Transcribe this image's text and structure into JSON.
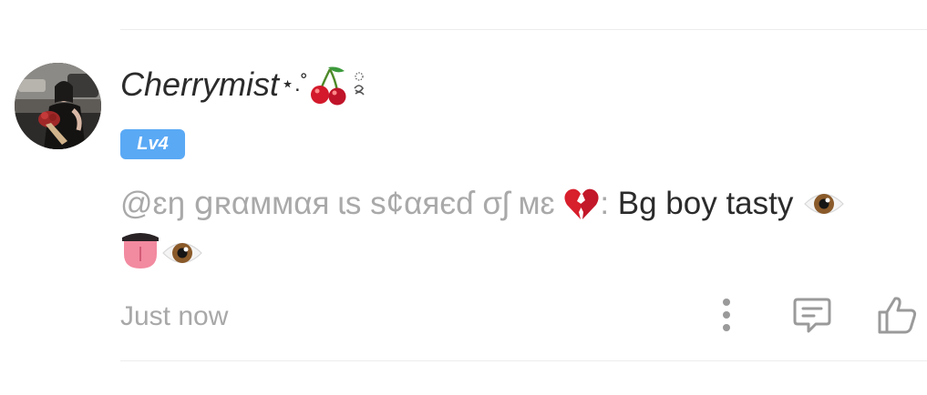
{
  "comment": {
    "username": "Cherrymist",
    "username_decoration": "⋆.˚",
    "level": "Lv4",
    "mention": "@ɛŋ ցʀαммαя ɩs s¢αяєɗ σʃ мɛ",
    "mention_suffix": ":",
    "body": " Bg boy tasty",
    "timestamp": "Just now",
    "emojis": [
      "broken-heart",
      "eye",
      "tongue",
      "eye"
    ]
  },
  "actions": {
    "more": "more-options",
    "reply": "reply",
    "like": "like"
  },
  "colors": {
    "badge": "#5aa9f5",
    "muted_text": "#a8a8a8",
    "main_text": "#2b2b2b",
    "icon": "#9a9a9a"
  }
}
